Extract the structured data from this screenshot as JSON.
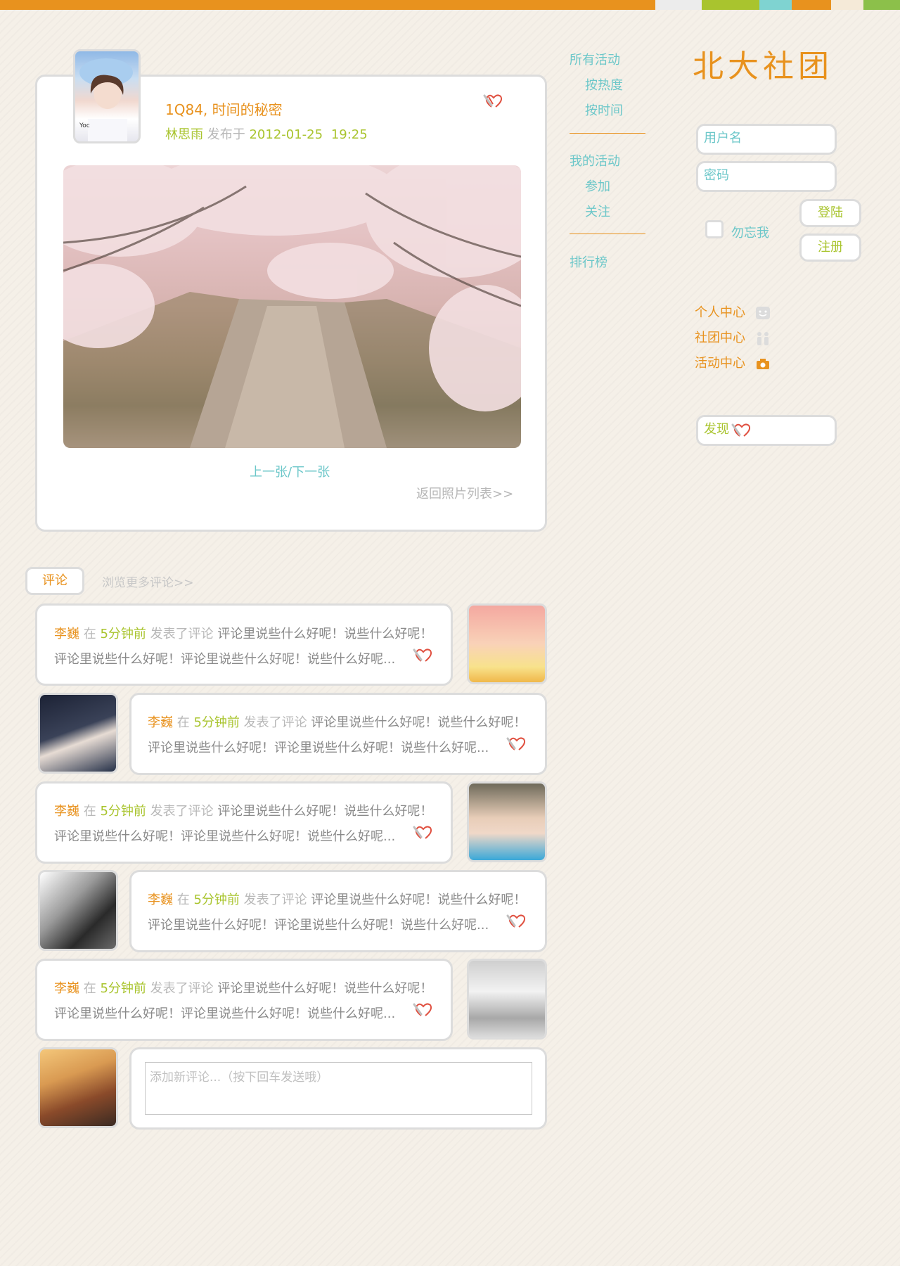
{
  "colors": {
    "accent": "#e8921e",
    "green": "#a9c42e",
    "cyan": "#6cc7c9",
    "gray": "#b8b8b8",
    "text": "#8a8a8a",
    "border": "#dcdcdc"
  },
  "brand": {
    "logo_text": "北大社团"
  },
  "post": {
    "title": "1Q84, 时间的秘密",
    "author": "林思雨",
    "published_label": "发布于",
    "date": "2012-01-25",
    "time": "19:25",
    "pager": "上一张/下一张",
    "back_link": "返回照片列表>>"
  },
  "nav": {
    "all_activities": "所有活动",
    "by_heat": "按热度",
    "by_time": "按时间",
    "my_activities": "我的活动",
    "joined": "参加",
    "followed": "关注",
    "ranking": "排行榜"
  },
  "login": {
    "username_placeholder": "用户名",
    "password_placeholder": "密码",
    "remember_label": "勿忘我",
    "login_button": "登陆",
    "register_button": "注册"
  },
  "centers": {
    "personal": "个人中心",
    "club": "社团中心",
    "activity": "活动中心"
  },
  "discover": {
    "label": "发现"
  },
  "comments_section": {
    "tab_label": "评论",
    "more_link": "浏览更多评论>>"
  },
  "comments": [
    {
      "user": "李巍",
      "at": "在",
      "time": "5分钟前",
      "action": "发表了评论",
      "line1": "评论里说些什么好呢！说些什么好呢！",
      "line2": "评论里说些什么好呢！评论里说些什么好呢！说些什么好呢..."
    },
    {
      "user": "李巍",
      "at": "在",
      "time": "5分钟前",
      "action": "发表了评论",
      "line1": "评论里说些什么好呢！说些什么好呢！",
      "line2": "评论里说些什么好呢！评论里说些什么好呢！说些什么好呢..."
    },
    {
      "user": "李巍",
      "at": "在",
      "time": "5分钟前",
      "action": "发表了评论",
      "line1": "评论里说些什么好呢！说些什么好呢！",
      "line2": "评论里说些什么好呢！评论里说些什么好呢！说些什么好呢..."
    },
    {
      "user": "李巍",
      "at": "在",
      "time": "5分钟前",
      "action": "发表了评论",
      "line1": "评论里说些什么好呢！说些什么好呢！",
      "line2": "评论里说些什么好呢！评论里说些什么好呢！说些什么好呢..."
    },
    {
      "user": "李巍",
      "at": "在",
      "time": "5分钟前",
      "action": "发表了评论",
      "line1": "评论里说些什么好呢！说些什么好呢！",
      "line2": "评论里说些什么好呢！评论里说些什么好呢！说些什么好呢..."
    }
  ],
  "new_comment": {
    "placeholder": "添加新评论...（按下回车发送哦）"
  }
}
